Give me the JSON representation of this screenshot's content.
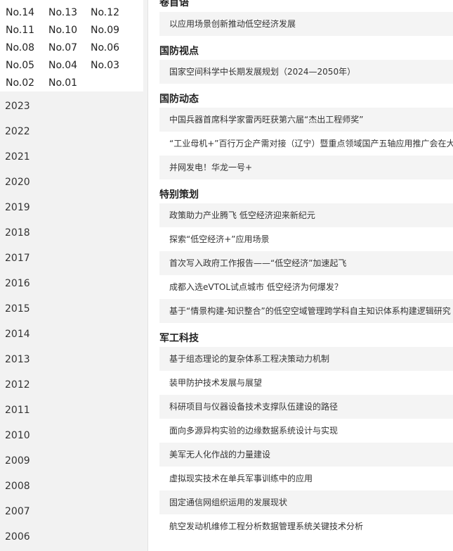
{
  "issues": [
    "No.14",
    "No.13",
    "No.12",
    "No.11",
    "No.10",
    "No.09",
    "No.08",
    "No.07",
    "No.06",
    "No.05",
    "No.04",
    "No.03",
    "No.02",
    "No.01"
  ],
  "years": [
    "2023",
    "2022",
    "2021",
    "2020",
    "2019",
    "2018",
    "2017",
    "2016",
    "2015",
    "2014",
    "2013",
    "2012",
    "2011",
    "2010",
    "2009",
    "2008",
    "2007",
    "2006"
  ],
  "sections": [
    {
      "title": "卷首语",
      "items": [
        "以应用场景创新推动低空经济发展"
      ]
    },
    {
      "title": "国防视点",
      "items": [
        "国家空间科学中长期发展规划（2024—2050年）"
      ]
    },
    {
      "title": "国防动态",
      "items": [
        "中国兵器首席科学家雷丙旺获第六届“杰出工程师奖”",
        "“工业母机+”百行万企产需对接（辽宁）暨重点领域国产五轴应用推广会在大",
        "并网发电！华龙一号+"
      ]
    },
    {
      "title": "特别策划",
      "items": [
        "政策助力产业腾飞 低空经济迎来新纪元",
        "探索“低空经济+”应用场景",
        "首次写入政府工作报告——“低空经济”加速起飞",
        "成都入选eVTOL试点城市 低空经济为何爆发？",
        "基于“情景构建-知识整合”的低空空域管理跨学科自主知识体系构建逻辑研究"
      ]
    },
    {
      "title": "军工科技",
      "items": [
        "基于组态理论的复杂体系工程决策动力机制",
        "装甲防护技术发展与展望",
        "科研项目与仪器设备技术支撑队伍建设的路径",
        "面向多源异构实验的边缘数据系统设计与实现",
        "美军无人化作战的力量建设",
        "虚拟现实技术在单兵军事训练中的应用",
        "固定通信网组织运用的发展现状",
        "航空发动机维修工程分析数据管理系统关键技术分析"
      ]
    }
  ]
}
